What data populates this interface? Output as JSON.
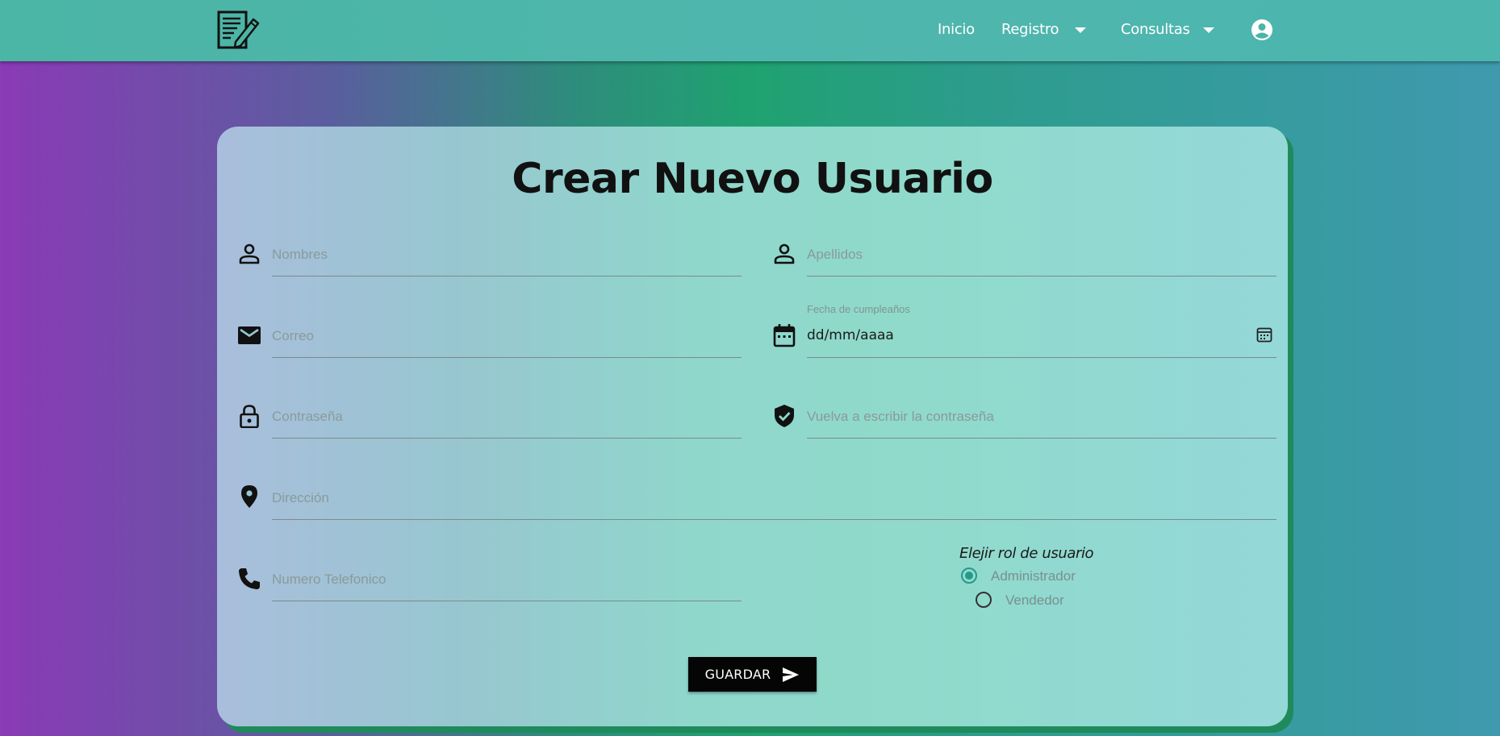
{
  "nav": {
    "home": "Inicio",
    "register": "Registro",
    "queries": "Consultas"
  },
  "form": {
    "title": "Crear Nuevo Usuario",
    "fields": {
      "first_name_placeholder": "Nombres",
      "last_name_placeholder": "Apellidos",
      "email_placeholder": "Correo",
      "birthday_label": "Fecha de cumpleaños",
      "birthday_value": "dd/mm/aaaa",
      "password_placeholder": "Contraseña",
      "confirm_password_placeholder": "Vuelva a escribir la contraseña",
      "address_placeholder": "Dirección",
      "phone_placeholder": "Numero Telefonico"
    },
    "role": {
      "label": "Elejir rol de usuario",
      "options": [
        "Administrador",
        "Vendedor"
      ],
      "selected": "Administrador"
    },
    "save_label": "GUARDAR"
  },
  "colors": {
    "navbar": "#4bb5a6",
    "accent": "#23998a",
    "button": "#050505"
  }
}
